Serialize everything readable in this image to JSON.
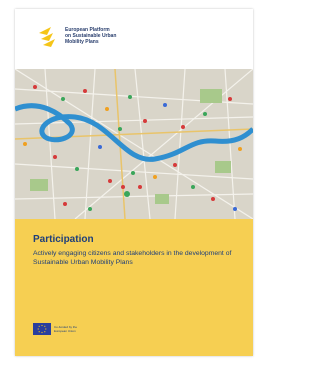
{
  "logo": {
    "line1": "European Platform",
    "line2": "on Sustainable Urban",
    "line3": "Mobility Plans"
  },
  "title": "Participation",
  "subtitle": "Actively engaging citizens and stakeholders in the development of Sustainable Urban Mobility Plans",
  "funding": {
    "line1": "Co-funded by the",
    "line2": "European Union"
  },
  "colors": {
    "accent_yellow": "#f6cf52",
    "navy": "#1f3f7a",
    "river_blue": "#2f8fd0",
    "eu_blue": "#2a3f9e"
  },
  "icons": {
    "logo": "platform-logo-icon",
    "flag": "eu-flag-icon"
  }
}
